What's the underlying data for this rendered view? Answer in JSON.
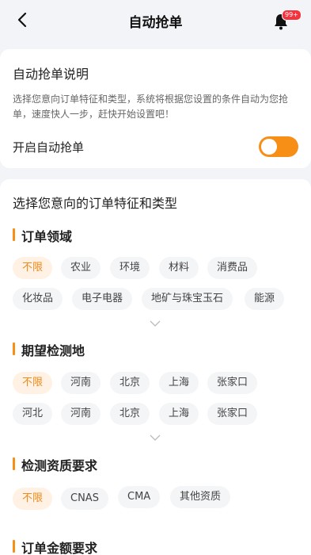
{
  "header": {
    "title": "自动抢单",
    "badge": "99+"
  },
  "intro": {
    "title": "自动抢单说明",
    "description": "选择您意向订单特征和类型，系统将根据您设置的条件自动为您抢单，速度快人一步，赶快开始设置吧！",
    "toggle_label": "开启自动抢单",
    "toggle_on": false
  },
  "prefs": {
    "title": "选择您意向的订单特征和类型",
    "sections": [
      {
        "title": "订单领域",
        "chips": [
          "不限",
          "农业",
          "环境",
          "材料",
          "消费品",
          "化妆品",
          "电子电器",
          "地矿与珠宝玉石",
          "能源"
        ]
      },
      {
        "title": "期望检测地",
        "chips": [
          "不限",
          "河南",
          "北京",
          "上海",
          "张家口",
          "河北",
          "河南",
          "北京",
          "上海",
          "张家口"
        ]
      },
      {
        "title": "检测资质要求",
        "chips": [
          "不限",
          "CNAS",
          "CMA",
          "其他资质"
        ]
      },
      {
        "title": "订单金额要求"
      }
    ]
  },
  "colors": {
    "accent": "#f78f17",
    "badge": "#f5333f",
    "background": "#f3f4f8"
  },
  "icons": [
    "back-arrow-icon",
    "bell-icon",
    "chevron-down-icon"
  ]
}
